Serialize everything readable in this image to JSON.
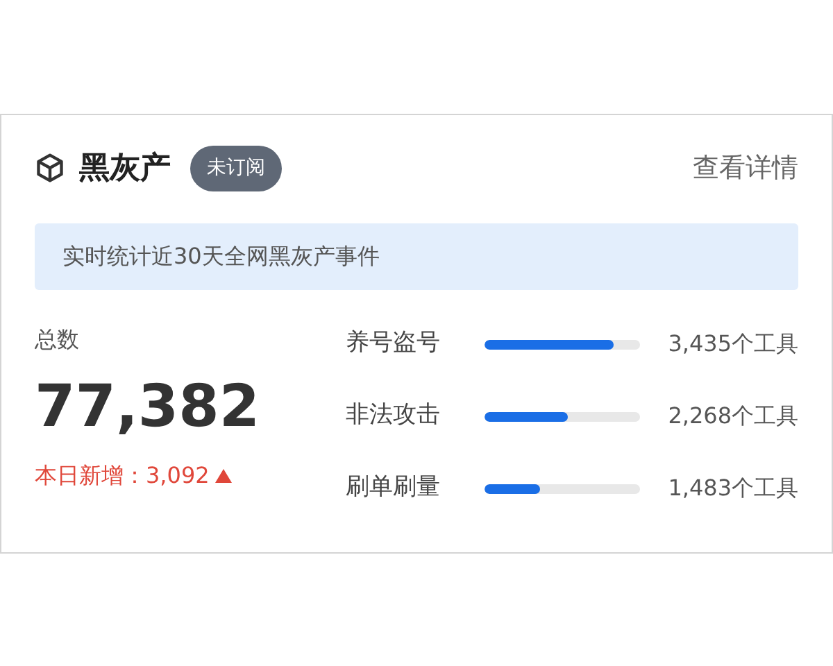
{
  "header": {
    "title": "黑灰产",
    "badge": "未订阅",
    "link": "查看详情"
  },
  "banner": "实时统计近30天全网黑灰产事件",
  "total": {
    "label": "总数",
    "value": "77,382",
    "today_label": "本日新增：",
    "today_value": "3,092",
    "rising": true
  },
  "stats": [
    {
      "name": "养号盗号",
      "level": 0.83,
      "reading": "3,435个工具"
    },
    {
      "name": "非法攻击",
      "level": 0.54,
      "reading": "2,268个工具"
    },
    {
      "name": "刷单刷量",
      "level": 0.36,
      "reading": "1,483个工具"
    }
  ]
}
